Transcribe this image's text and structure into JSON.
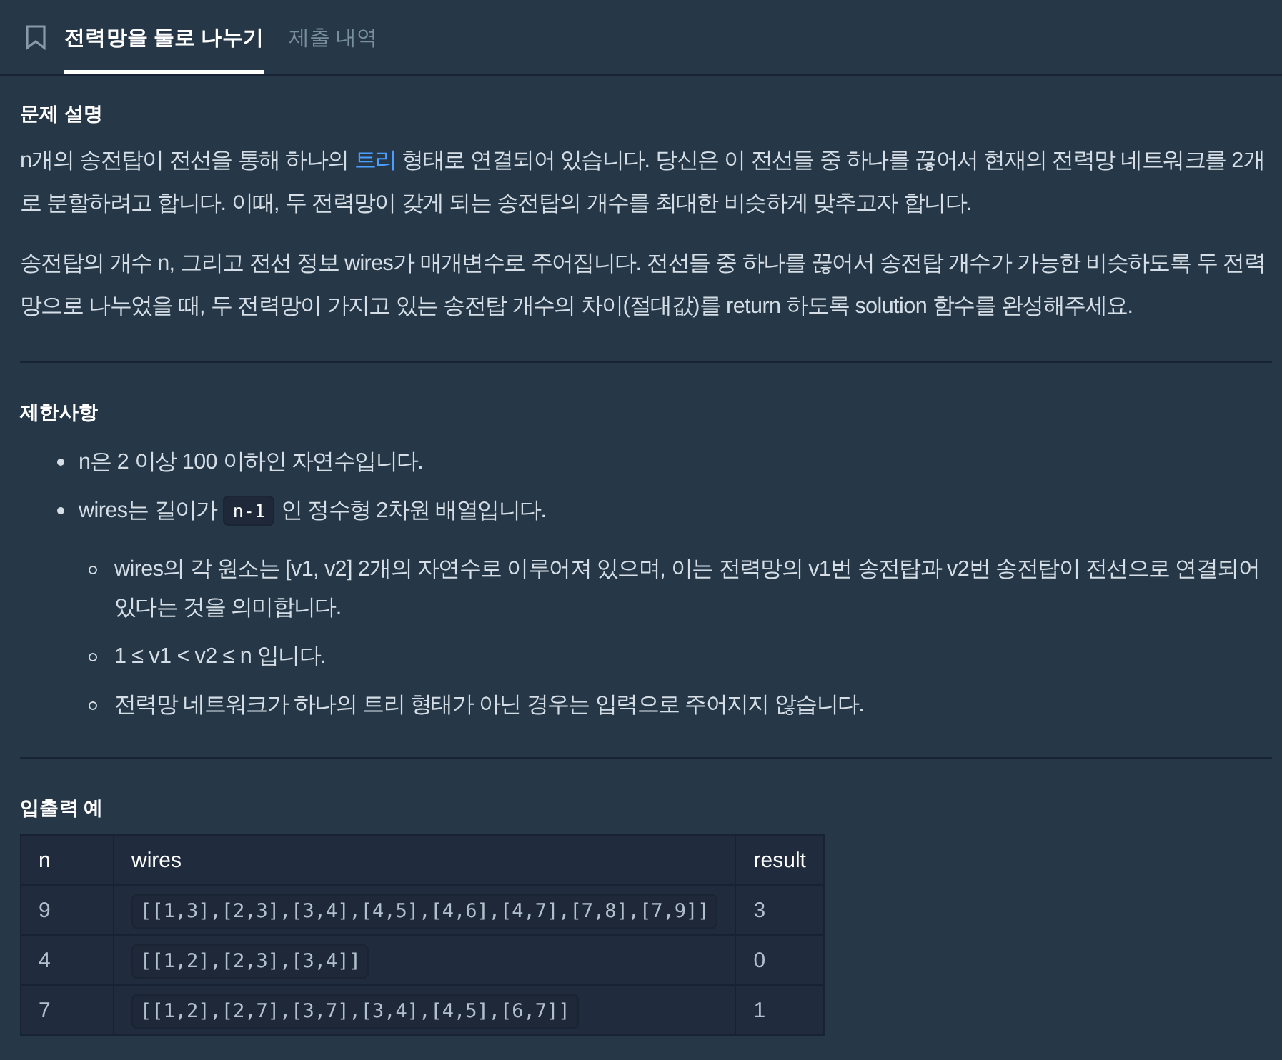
{
  "tabs": [
    {
      "label": "전력망을 둘로 나누기",
      "selected": true
    },
    {
      "label": "제출 내역",
      "selected": false
    }
  ],
  "sections": [
    {
      "kind": "text",
      "heading": "문제 설명",
      "paragraphs": [
        [
          {
            "kind": "text",
            "text": "n개의 송전탑이 전선을 통해 하나의 "
          },
          {
            "kind": "link",
            "text": "트리"
          },
          {
            "kind": "text",
            "text": " 형태로 연결되어 있습니다. 당신은 이 전선들 중 하나를 끊어서 현재의 전력망 네트워크를 2개로 분할하려고 합니다. 이때, 두 전력망이 갖게 되는 송전탑의 개수를 최대한 비슷하게 맞추고자 합니다."
          }
        ],
        [
          {
            "kind": "text",
            "text": "송전탑의 개수 n, 그리고 전선 정보 wires가 매개변수로 주어집니다. 전선들 중 하나를 끊어서 송전탑 개수가 가능한 비슷하도록 두 전력망으로 나누었을 때, 두 전력망이 가지고 있는 송전탑 개수의 차이(절대값)를 return 하도록 solution 함수를 완성해주세요."
          }
        ]
      ]
    },
    {
      "kind": "list",
      "heading": "제한사항",
      "items": [
        {
          "segments": [
            {
              "kind": "text",
              "text": "n은 2 이상 100 이하인 자연수입니다."
            }
          ]
        },
        {
          "segments": [
            {
              "kind": "text",
              "text": "wires는 길이가 "
            },
            {
              "kind": "code",
              "text": "n-1"
            },
            {
              "kind": "text",
              "text": " 인 정수형 2차원 배열입니다."
            }
          ],
          "children": [
            {
              "segments": [
                {
                  "kind": "text",
                  "text": "wires의 각 원소는 [v1, v2] 2개의 자연수로 이루어져 있으며, 이는 전력망의 v1번 송전탑과 v2번 송전탑이 전선으로 연결되어 있다는 것을 의미합니다."
                }
              ]
            },
            {
              "segments": [
                {
                  "kind": "text",
                  "text": "1 ≤ v1 < v2 ≤ n 입니다."
                }
              ]
            },
            {
              "segments": [
                {
                  "kind": "text",
                  "text": "전력망 네트워크가 하나의 트리 형태가 아닌 경우는 입력으로 주어지지 않습니다."
                }
              ]
            }
          ]
        }
      ]
    },
    {
      "kind": "table",
      "heading": "입출력 예",
      "columns": [
        {
          "label": "n",
          "kind": "plain"
        },
        {
          "label": "wires",
          "kind": "code"
        },
        {
          "label": "result",
          "kind": "plain"
        }
      ],
      "rows": [
        [
          "9",
          "[[1,3],[2,3],[3,4],[4,5],[4,6],[4,7],[7,8],[7,9]]",
          "3"
        ],
        [
          "4",
          "[[1,2],[2,3],[3,4]]",
          "0"
        ],
        [
          "7",
          "[[1,2],[2,7],[3,7],[3,4],[4,5],[6,7]]",
          "1"
        ]
      ]
    }
  ]
}
